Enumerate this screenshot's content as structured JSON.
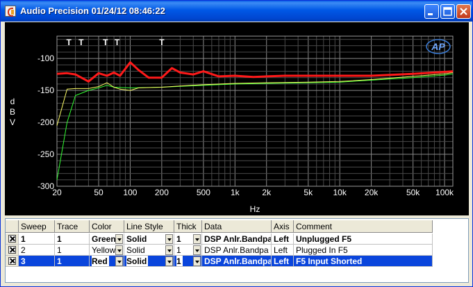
{
  "window": {
    "title": "Audio Precision  01/24/12 08:46:22"
  },
  "controls": {
    "minimize": "minimize",
    "maximize": "maximize",
    "close": "close"
  },
  "logo": {
    "text": "AP"
  },
  "chart_data": {
    "type": "line",
    "title": "",
    "xlabel": "Hz",
    "ylabel": "dBV",
    "ylabel_letters": [
      "d",
      "B",
      "V"
    ],
    "x_scale": "log",
    "xlim": [
      20,
      120000
    ],
    "ylim": [
      -300,
      -65
    ],
    "grid": true,
    "yticks": [
      -100,
      -150,
      -200,
      -250,
      -300
    ],
    "xticks": [
      {
        "value": 20,
        "label": "20"
      },
      {
        "value": 50,
        "label": "50"
      },
      {
        "value": 100,
        "label": "100"
      },
      {
        "value": 200,
        "label": "200"
      },
      {
        "value": 500,
        "label": "500"
      },
      {
        "value": 1000,
        "label": "1k"
      },
      {
        "value": 2000,
        "label": "2k"
      },
      {
        "value": 5000,
        "label": "5k"
      },
      {
        "value": 10000,
        "label": "10k"
      },
      {
        "value": 20000,
        "label": "20k"
      },
      {
        "value": 50000,
        "label": "50k"
      },
      {
        "value": 100000,
        "label": "100k"
      }
    ],
    "markers": {
      "label": "T",
      "x": [
        26,
        34,
        58,
        75,
        200
      ]
    },
    "series": [
      {
        "color": "#33ff33",
        "width": 1,
        "points": [
          [
            20,
            -290
          ],
          [
            25,
            -200
          ],
          [
            30,
            -158
          ],
          [
            40,
            -150
          ],
          [
            50,
            -146
          ],
          [
            60,
            -142
          ],
          [
            70,
            -145
          ],
          [
            100,
            -146
          ],
          [
            200,
            -145
          ],
          [
            500,
            -142
          ],
          [
            1000,
            -140
          ],
          [
            2000,
            -139
          ],
          [
            5000,
            -138
          ],
          [
            10000,
            -137
          ],
          [
            20000,
            -134
          ],
          [
            50000,
            -130
          ],
          [
            100000,
            -126
          ],
          [
            120000,
            -124
          ]
        ]
      },
      {
        "color": "#ffff66",
        "width": 1,
        "points": [
          [
            20,
            -205
          ],
          [
            25,
            -148
          ],
          [
            30,
            -147
          ],
          [
            40,
            -147
          ],
          [
            50,
            -144
          ],
          [
            60,
            -138
          ],
          [
            70,
            -145
          ],
          [
            80,
            -148
          ],
          [
            100,
            -150
          ],
          [
            120,
            -146
          ],
          [
            200,
            -145
          ],
          [
            300,
            -143
          ],
          [
            500,
            -141
          ],
          [
            1000,
            -139
          ],
          [
            2000,
            -138
          ],
          [
            5000,
            -137
          ],
          [
            10000,
            -136
          ],
          [
            20000,
            -133
          ],
          [
            50000,
            -128
          ],
          [
            100000,
            -124
          ],
          [
            120000,
            -122
          ]
        ]
      },
      {
        "color": "#ff1a1a",
        "width": 3,
        "points": [
          [
            20,
            -124
          ],
          [
            25,
            -123
          ],
          [
            30,
            -125
          ],
          [
            40,
            -136
          ],
          [
            50,
            -123
          ],
          [
            60,
            -127
          ],
          [
            70,
            -122
          ],
          [
            80,
            -127
          ],
          [
            100,
            -106
          ],
          [
            120,
            -118
          ],
          [
            150,
            -130
          ],
          [
            200,
            -130
          ],
          [
            250,
            -115
          ],
          [
            300,
            -122
          ],
          [
            400,
            -125
          ],
          [
            500,
            -120
          ],
          [
            700,
            -128
          ],
          [
            1000,
            -127
          ],
          [
            1500,
            -129
          ],
          [
            2000,
            -128
          ],
          [
            3000,
            -127
          ],
          [
            5000,
            -127
          ],
          [
            10000,
            -127
          ],
          [
            20000,
            -127
          ],
          [
            50000,
            -124
          ],
          [
            100000,
            -121
          ],
          [
            120000,
            -120
          ]
        ]
      }
    ]
  },
  "table": {
    "headers": [
      "Sweep",
      "Trace",
      "Color",
      "Line Style",
      "Thick",
      "Data",
      "Axis",
      "Comment"
    ],
    "rows": [
      {
        "sweep": "1",
        "trace": "1",
        "color": "Green",
        "line_style": "Solid",
        "thick": "1",
        "data": "DSP Anlr.Bandpa",
        "axis": "Left",
        "comment": "Unplugged F5"
      },
      {
        "sweep": "2",
        "trace": "1",
        "color": "Yellow",
        "line_style": "Solid",
        "thick": "1",
        "data": "DSP Anlr.Bandpa",
        "axis": "Left",
        "comment": "Plugged In F5"
      },
      {
        "sweep": "3",
        "trace": "1",
        "color": "Red",
        "line_style": "Solid",
        "thick": "1",
        "data": "DSP Anlr.Bandpa",
        "axis": "Left",
        "comment": "F5 Input Shorted"
      }
    ]
  }
}
